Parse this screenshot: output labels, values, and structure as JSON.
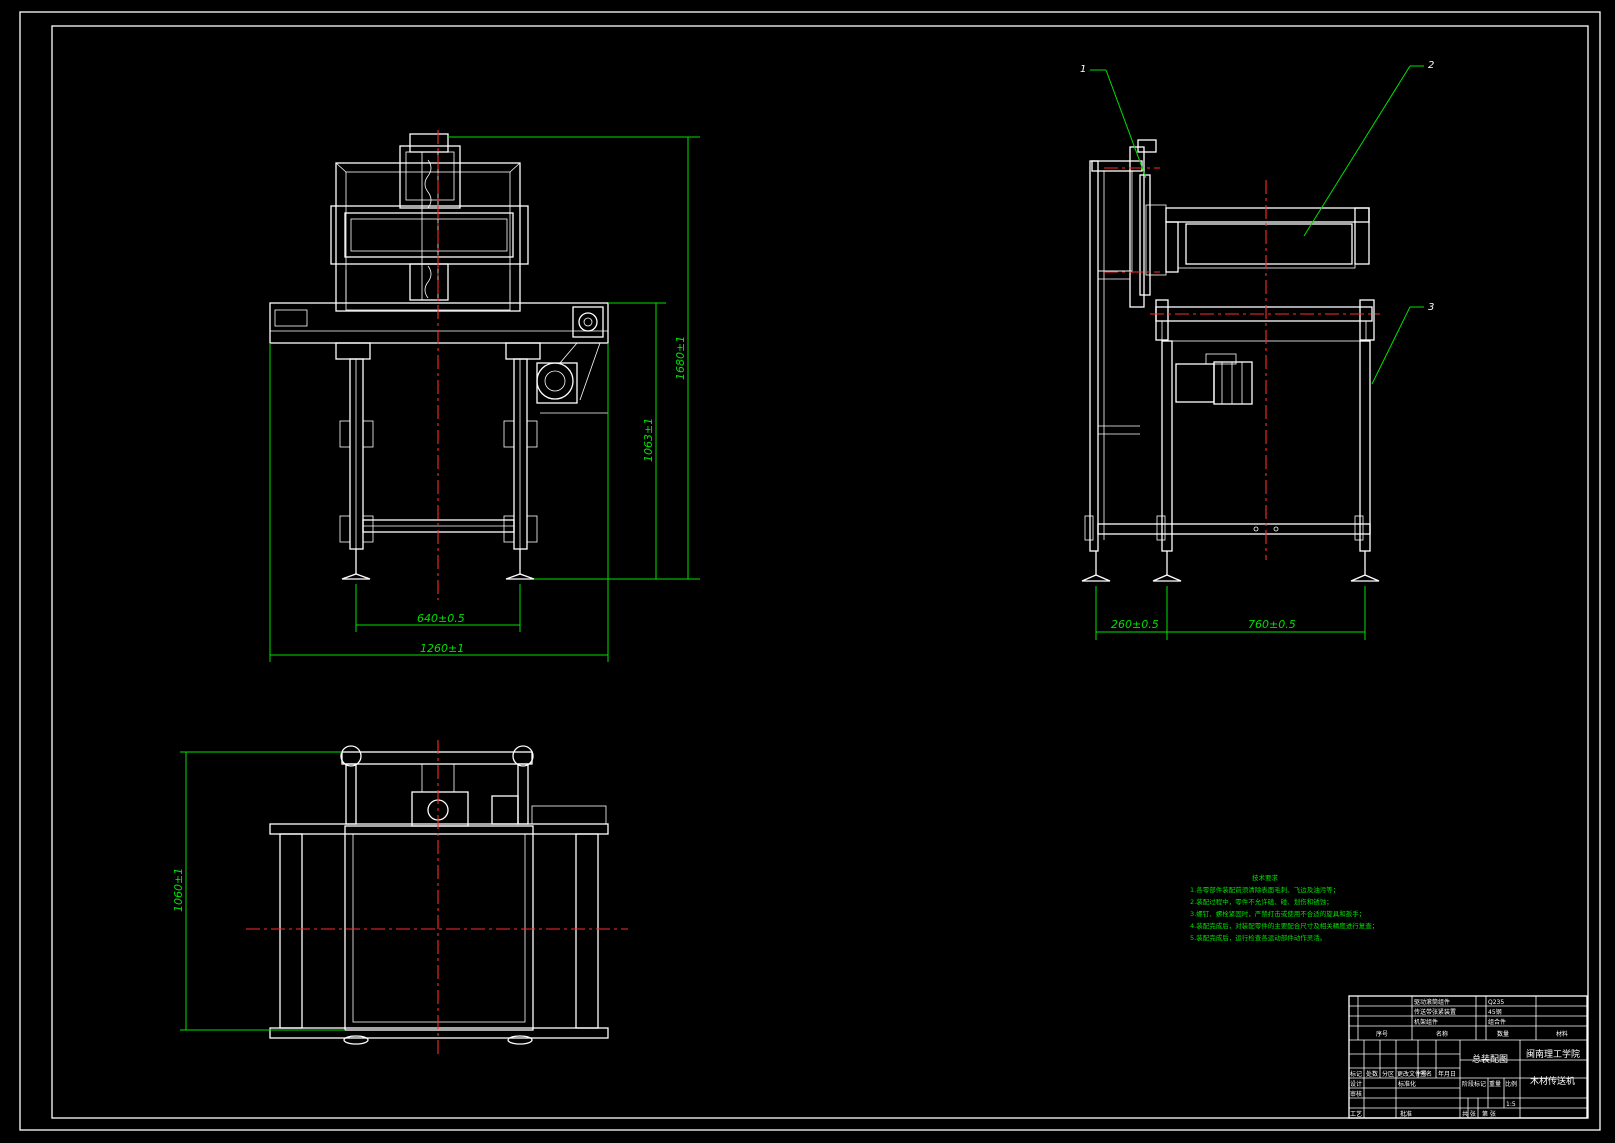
{
  "colors": {
    "background": "#000000",
    "outline": "#ffffff",
    "dimension": "#00e000",
    "centerline": "#ff2a2a"
  },
  "front_view": {
    "dims": {
      "height_total": "1680±1",
      "height_table": "1063±1",
      "leg_span": "640±0.5",
      "width_total": "1260±1"
    }
  },
  "side_view": {
    "dims": {
      "front_offset": "260±0.5",
      "depth": "760±0.5"
    },
    "callouts": [
      "1",
      "2",
      "3"
    ]
  },
  "top_view": {
    "dims": {
      "depth": "1060±1"
    }
  },
  "tech_notes": {
    "title": "技术要求",
    "items": [
      "1.各零部件装配前须清除表面毛刺、飞边及油污等；",
      "2.装配过程中，零件不允许磕、碰、划伤和锈蚀；",
      "3.螺钉、螺栓紧固时，严禁打击或使用不合适的旋具和扳手；",
      "4.装配完成后，对装配零件的主要配合尺寸及相关精度进行复查；",
      "5.装配完成后，运行检查各运动部件动作灵活。"
    ]
  },
  "title_block": {
    "drawing_name": "总装配图",
    "school": "闽南理工学院",
    "product": "木材传送机",
    "scale": "1:5",
    "labels": {
      "mark": "标记",
      "count": "处数",
      "zone": "分区",
      "change_doc": "更改文件号",
      "sign": "签名",
      "date": "年月日",
      "design": "设计",
      "standard": "标准化",
      "review": "审核",
      "process": "工艺",
      "approve": "批准",
      "stage_mark": "阶段标记",
      "weight": "重量",
      "ratio": "比例",
      "sheet_total": "共 张",
      "sheet_no": "第 张",
      "seq": "序号",
      "name": "名称",
      "qty": "数量",
      "material": "材料",
      "part_a": "驱动滚筒组件",
      "part_b": "传送带张紧装置",
      "part_c": "机架组件",
      "spec_a": "Q235",
      "spec_b": "45钢",
      "spec_c": "组合件"
    }
  }
}
